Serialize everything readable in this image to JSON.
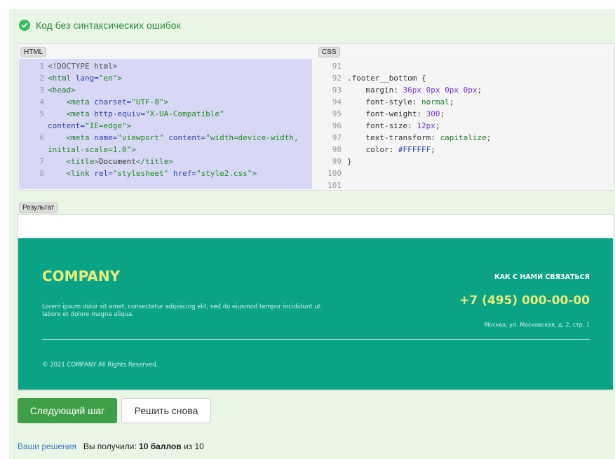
{
  "status": {
    "text": "Код без синтаксических ошибок",
    "icon": "check-circle-icon"
  },
  "editors": {
    "html_tag": "HTML",
    "css_tag": "CSS",
    "html_lines": [
      {
        "n": "1",
        "tokens": [
          {
            "c": "t-doc",
            "t": "<!DOCTYPE html>"
          }
        ]
      },
      {
        "n": "2",
        "tokens": [
          {
            "c": "t-tag",
            "t": "<html "
          },
          {
            "c": "t-attr",
            "t": "lang="
          },
          {
            "c": "t-str",
            "t": "\"en\""
          },
          {
            "c": "t-tag",
            "t": ">"
          }
        ]
      },
      {
        "n": "3",
        "tokens": [
          {
            "c": "t-tag",
            "t": "<head>"
          }
        ]
      },
      {
        "n": "4",
        "tokens": [
          {
            "c": "t-tag",
            "t": "    <meta "
          },
          {
            "c": "t-attr",
            "t": "charset="
          },
          {
            "c": "t-str",
            "t": "\"UTF-8\""
          },
          {
            "c": "t-tag",
            "t": ">"
          }
        ]
      },
      {
        "n": "5",
        "tokens": [
          {
            "c": "t-tag",
            "t": "    <meta "
          },
          {
            "c": "t-attr",
            "t": "http-equiv="
          },
          {
            "c": "t-str",
            "t": "\"X-UA-Compatible\""
          }
        ]
      },
      {
        "n": "",
        "tokens": [
          {
            "c": "t-attr",
            "t": "content="
          },
          {
            "c": "t-str",
            "t": "\"IE=edge\""
          },
          {
            "c": "t-tag",
            "t": ">"
          }
        ]
      },
      {
        "n": "6",
        "tokens": [
          {
            "c": "t-tag",
            "t": "    <meta "
          },
          {
            "c": "t-attr",
            "t": "name="
          },
          {
            "c": "t-str",
            "t": "\"viewport\" "
          },
          {
            "c": "t-attr",
            "t": "content="
          },
          {
            "c": "t-str",
            "t": "\"width=device-width,"
          }
        ]
      },
      {
        "n": "",
        "tokens": [
          {
            "c": "t-str",
            "t": "initial-scale=1.0\""
          },
          {
            "c": "t-tag",
            "t": ">"
          }
        ]
      },
      {
        "n": "7",
        "tokens": [
          {
            "c": "t-tag",
            "t": "    <title>"
          },
          {
            "c": "t-plain",
            "t": "Document"
          },
          {
            "c": "t-tag",
            "t": "</title>"
          }
        ]
      },
      {
        "n": "8",
        "tokens": [
          {
            "c": "t-tag",
            "t": "    <link "
          },
          {
            "c": "t-attr",
            "t": "rel="
          },
          {
            "c": "t-str",
            "t": "\"stylesheet\" "
          },
          {
            "c": "t-attr",
            "t": "href="
          },
          {
            "c": "t-str",
            "t": "\"style2.css\""
          },
          {
            "c": "t-tag",
            "t": ">"
          }
        ]
      }
    ],
    "css_lines": [
      {
        "n": "91",
        "tokens": []
      },
      {
        "n": "92",
        "tokens": [
          {
            "c": "t-plain",
            "t": ".footer__bottom {"
          }
        ]
      },
      {
        "n": "93",
        "tokens": [
          {
            "c": "t-plain",
            "t": "    margin: "
          },
          {
            "c": "t-num",
            "t": "36px 0px 0px 0px"
          },
          {
            "c": "t-plain",
            "t": ";"
          }
        ]
      },
      {
        "n": "94",
        "tokens": [
          {
            "c": "t-plain",
            "t": "    font-style: "
          },
          {
            "c": "t-kw",
            "t": "normal"
          },
          {
            "c": "t-plain",
            "t": ";"
          }
        ]
      },
      {
        "n": "95",
        "tokens": [
          {
            "c": "t-plain",
            "t": "    font-weight: "
          },
          {
            "c": "t-num",
            "t": "300"
          },
          {
            "c": "t-plain",
            "t": ";"
          }
        ]
      },
      {
        "n": "96",
        "tokens": [
          {
            "c": "t-plain",
            "t": "    font-size: "
          },
          {
            "c": "t-num",
            "t": "12px"
          },
          {
            "c": "t-plain",
            "t": ";"
          }
        ]
      },
      {
        "n": "97",
        "tokens": [
          {
            "c": "t-plain",
            "t": "    text-transform: "
          },
          {
            "c": "t-kw",
            "t": "capitalize"
          },
          {
            "c": "t-plain",
            "t": ";"
          }
        ]
      },
      {
        "n": "98",
        "tokens": [
          {
            "c": "t-plain",
            "t": "    color: "
          },
          {
            "c": "t-attr",
            "t": "#FFFFFF"
          },
          {
            "c": "t-plain",
            "t": ";"
          }
        ]
      },
      {
        "n": "99",
        "tokens": [
          {
            "c": "t-plain",
            "t": "}"
          }
        ]
      },
      {
        "n": "100",
        "tokens": []
      },
      {
        "n": "101",
        "tokens": []
      }
    ]
  },
  "result": {
    "tag": "Результат",
    "company": "COMPANY",
    "lorem": "Lorem ipsum dolor sit amet, consectetur adipiscing elit, sed do eiusmod tempor incididunt ut labore et dolore magna aliqua.",
    "contact_title": "КАК С НАМИ СВЯЗАТЬСЯ",
    "phone": "+7 (495) 000-00-00",
    "address": "Москва, ул. Московская, д. 2, стр. 1",
    "copyright": "© 2021 COMPANY All Rights Reserved."
  },
  "actions": {
    "next_label": "Следующий шаг",
    "retry_label": "Решить снова"
  },
  "summary": {
    "link_text": "Ваши решения",
    "score_prefix": "Вы получили:",
    "score_value": "10 баллов",
    "score_suffix": "из 10"
  },
  "colors": {
    "panel": "#e9f6e6",
    "footer": "#0aa386",
    "accent_yellow": "#e8ee7c",
    "button_green": "#3f9f48"
  }
}
